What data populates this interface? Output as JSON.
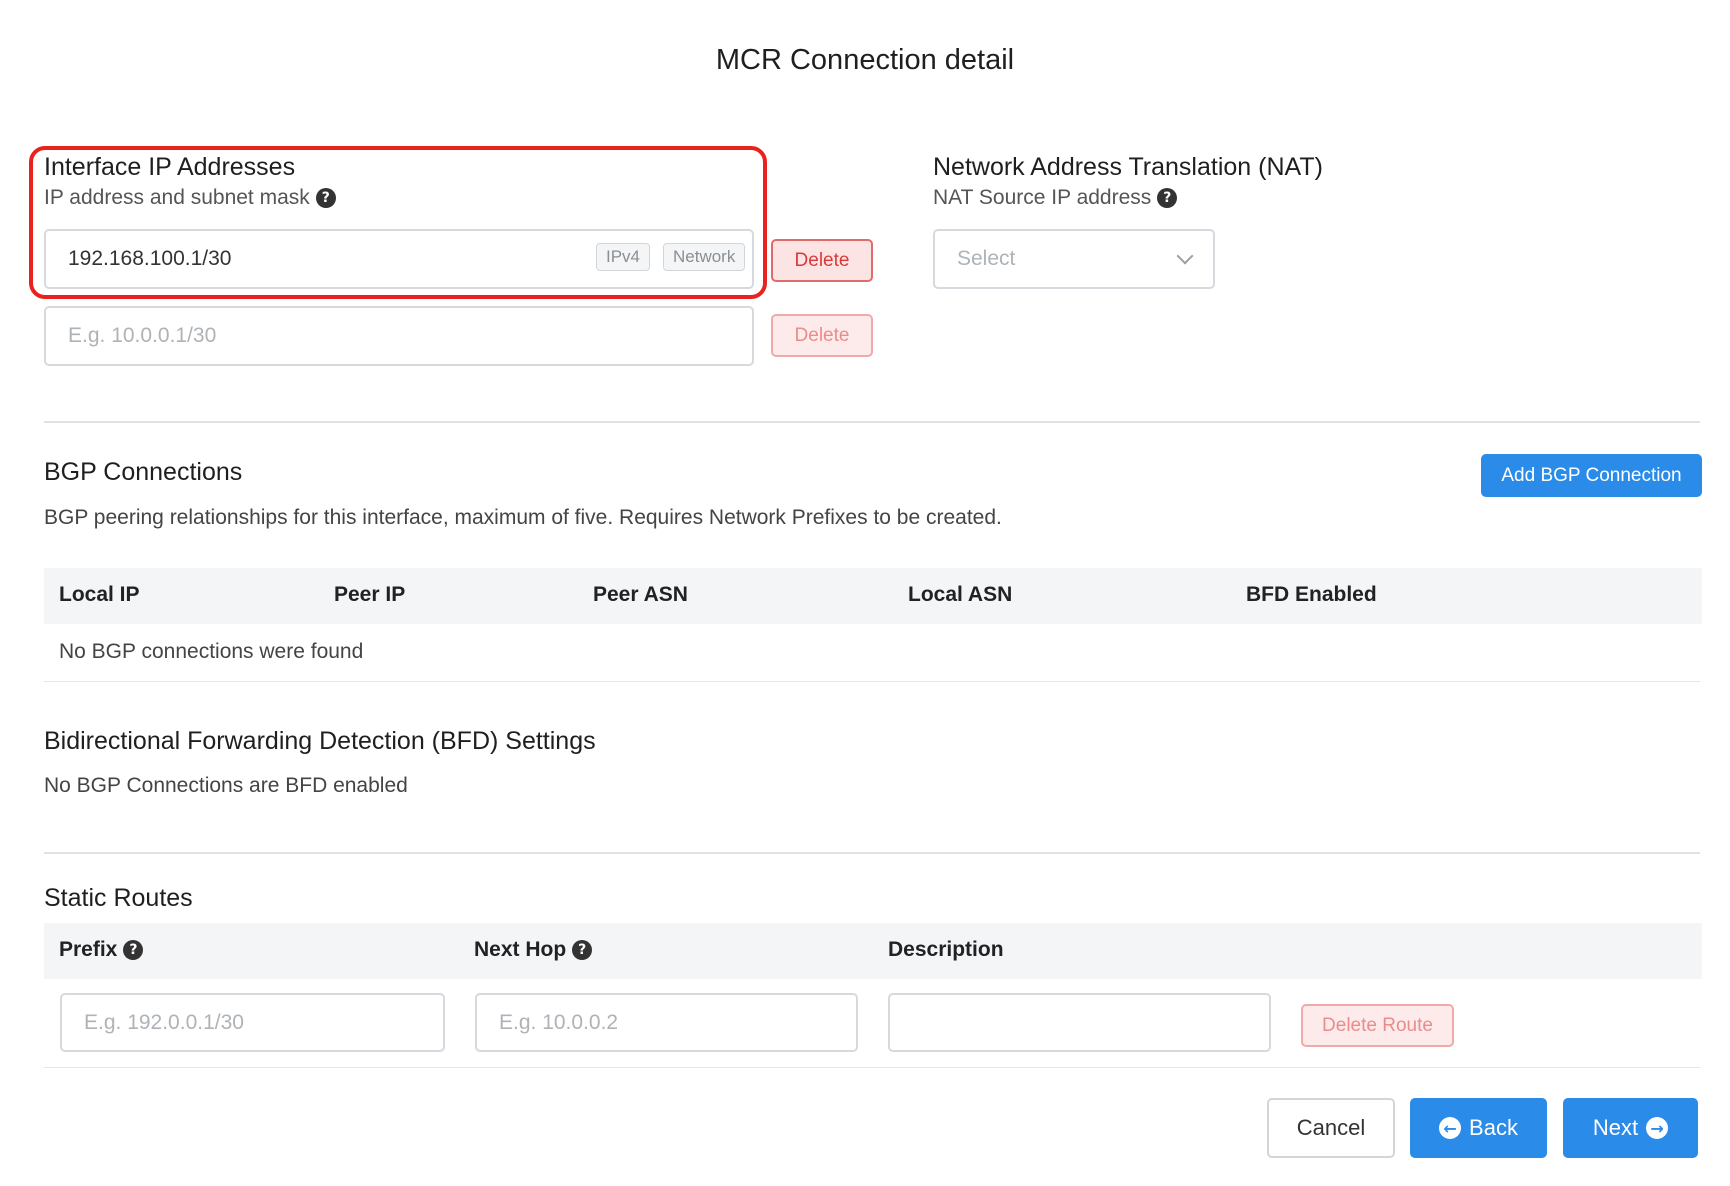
{
  "page": {
    "title": "MCR Connection detail"
  },
  "interface_ip": {
    "title": "Interface IP Addresses",
    "subtitle": "IP address and subnet mask",
    "rows": [
      {
        "value": "192.168.100.1/30",
        "tags": [
          "IPv4",
          "Network"
        ],
        "delete_label": "Delete"
      },
      {
        "placeholder": "E.g. 10.0.0.1/30",
        "delete_label": "Delete"
      }
    ]
  },
  "nat": {
    "title": "Network Address Translation (NAT)",
    "subtitle": "NAT Source IP address",
    "select_placeholder": "Select"
  },
  "bgp": {
    "title": "BGP Connections",
    "description": "BGP peering relationships for this interface, maximum of five. Requires Network Prefixes to be created.",
    "add_label": "Add BGP Connection",
    "columns": [
      "Local IP",
      "Peer IP",
      "Peer ASN",
      "Local ASN",
      "BFD Enabled"
    ],
    "empty_text": "No BGP connections were found"
  },
  "bfd": {
    "title": "Bidirectional Forwarding Detection (BFD) Settings",
    "text": "No BGP Connections are BFD enabled"
  },
  "static_routes": {
    "title": "Static Routes",
    "columns": [
      "Prefix",
      "Next Hop",
      "Description"
    ],
    "prefix_placeholder": "E.g. 192.0.0.1/30",
    "next_hop_placeholder": "E.g. 10.0.0.2",
    "description_value": "",
    "delete_label": "Delete Route"
  },
  "footer": {
    "cancel_label": "Cancel",
    "back_label": "Back",
    "next_label": "Next"
  },
  "colors": {
    "accent": "#2a8be8",
    "danger": "#d93a3a",
    "highlight": "#e8231f"
  }
}
